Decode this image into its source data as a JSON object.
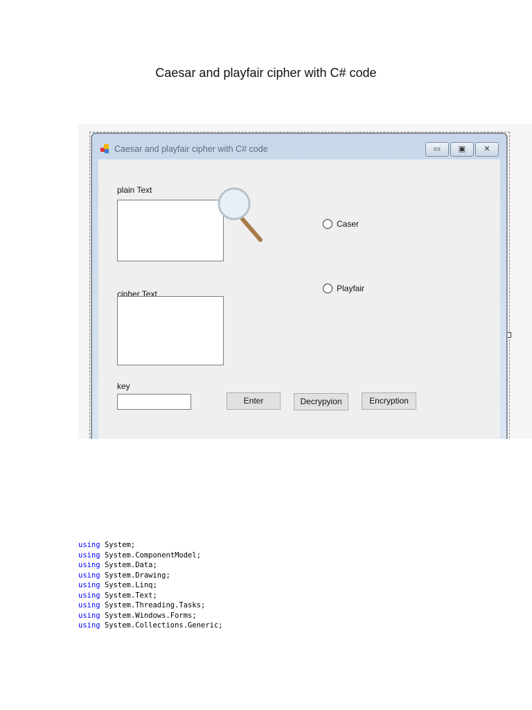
{
  "doc_title": "Caesar and playfair cipher with C# code",
  "window": {
    "title": "Caesar and playfair cipher with C# code",
    "controls": {
      "minimize": "▭",
      "maximize": "▣",
      "close": "✕"
    }
  },
  "form": {
    "plain_label": "plain Text",
    "cipher_label": "cipher Text",
    "key_label": "key",
    "radio_caesar": "Caser",
    "radio_playfair": "Playfair",
    "btn_enter": "Enter",
    "btn_decrypt": "Decrypyion",
    "btn_encrypt": "Encryption"
  },
  "code": {
    "keyword": "using",
    "lines": [
      "System;",
      "System.ComponentModel;",
      "System.Data;",
      "System.Drawing;",
      "System.Linq;",
      "System.Text;",
      "System.Threading.Tasks;",
      "System.Windows.Forms;",
      "System.Collections.Generic;"
    ]
  }
}
